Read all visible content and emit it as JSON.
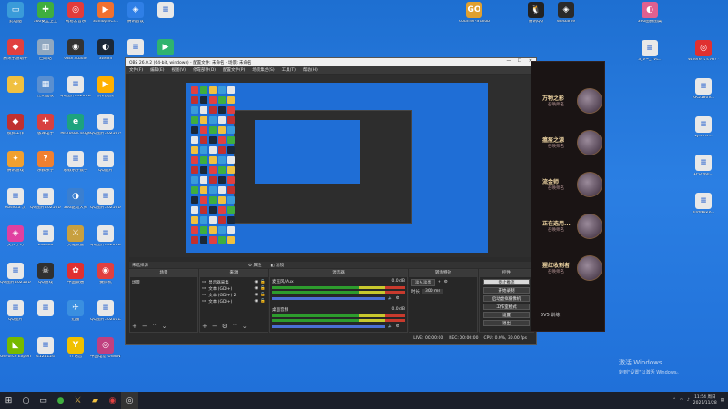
{
  "desktop_icons": [
    {
      "label": "此电脑",
      "color": "#3a9bd9",
      "glyph": "▭"
    },
    {
      "label": "360安全卫士",
      "color": "#3fae3f",
      "glyph": "✚"
    },
    {
      "label": "网易云音乐",
      "color": "#e33b3b",
      "glyph": "◎"
    },
    {
      "label": "SunloginCl...",
      "color": "#f07030",
      "glyph": "▶"
    },
    {
      "label": "腾讯会议",
      "color": "#2f7fe6",
      "glyph": "◈"
    },
    {
      "label": "",
      "color": "#e8e8e8",
      "glyph": ""
    },
    {
      "label": "腾讯手游助手",
      "color": "#e04040",
      "glyph": "◆"
    },
    {
      "label": "回收站",
      "color": "#8fa7c0",
      "glyph": "▥"
    },
    {
      "label": "OBS Studio",
      "color": "#333333",
      "glyph": "◉"
    },
    {
      "label": "Steam",
      "color": "#1b2838",
      "glyph": "◐"
    },
    {
      "label": "模式",
      "color": "#e8e8e8",
      "glyph": ""
    },
    {
      "label": "",
      "color": "#2fb36f",
      "glyph": "▶"
    },
    {
      "label": "",
      "color": "#f0c040",
      "glyph": "✦"
    },
    {
      "label": "控制面板",
      "color": "#5a8fd0",
      "glyph": "▦"
    },
    {
      "label": "QQ图片20201121...",
      "color": "#e8e8e8",
      "glyph": ""
    },
    {
      "label": "腾讯视频",
      "color": "#ffb000",
      "glyph": "▶"
    },
    {
      "label": "模式工作",
      "color": "#c03030",
      "glyph": "◆"
    },
    {
      "label": "极域电子",
      "color": "#d84040",
      "glyph": "✚"
    },
    {
      "label": "Microsoft Edge",
      "color": "#1da37e",
      "glyph": "e"
    },
    {
      "label": "QQ图片20210705...",
      "color": "#e8e8e8",
      "glyph": ""
    },
    {
      "label": "腾讯游戏",
      "color": "#f0a030",
      "glyph": "✦"
    },
    {
      "label": "乐教乐学",
      "color": "#f08030",
      "glyph": "?"
    },
    {
      "label": "乐教乐学数字",
      "color": "#e8e8e8",
      "glyph": ""
    },
    {
      "label": "QQ图片",
      "color": "#e8e8e8",
      "glyph": ""
    },
    {
      "label": "Rosetta 汉",
      "color": "#e8e8e8",
      "glyph": ""
    },
    {
      "label": "QQ图片20210107...",
      "color": "#e8e8e8",
      "glyph": ""
    },
    {
      "label": "360驱动大师",
      "color": "#3a7fd0",
      "glyph": "◑"
    },
    {
      "label": "QQ图片20210108...",
      "color": "#e8e8e8",
      "glyph": ""
    },
    {
      "label": "交大学习",
      "color": "#e040a0",
      "glyph": "◈"
    },
    {
      "label": "132380",
      "color": "#e8e8e8",
      "glyph": ""
    },
    {
      "label": "英雄联盟",
      "color": "#c8a040",
      "glyph": "⚔"
    },
    {
      "label": "QQ图片20201127...",
      "color": "#e8e8e8",
      "glyph": ""
    },
    {
      "label": "QQ图片20210107...",
      "color": "#e8e8e8",
      "glyph": ""
    },
    {
      "label": "QQ游戏",
      "color": "#303030",
      "glyph": "☠"
    },
    {
      "label": "中国联通",
      "color": "#e03030",
      "glyph": "✿"
    },
    {
      "label": "摄像机",
      "color": "#e04040",
      "glyph": "◉"
    },
    {
      "label": "QQ图片",
      "color": "#e8e8e8",
      "glyph": ""
    },
    {
      "label": "",
      "color": "#e8e8e8",
      "glyph": ""
    },
    {
      "label": "迅雷",
      "color": "#3a8fe0",
      "glyph": "✈"
    },
    {
      "label": "QQ图片20201126...",
      "color": "#e8e8e8",
      "glyph": ""
    },
    {
      "label": "GeForce Experience",
      "color": "#76b900",
      "glyph": "◣"
    },
    {
      "label": "4124124",
      "color": "#e8e8e8",
      "glyph": ""
    },
    {
      "label": "YY语音",
      "color": "#f0c000",
      "glyph": "Y"
    },
    {
      "label": "中国电信 UWAN...",
      "color": "#c04080",
      "glyph": "◎"
    },
    {
      "label": "79137cd...",
      "color": "#e8e8e8",
      "glyph": ""
    },
    {
      "label": "360安全浏览器",
      "color": "#3fae3f",
      "glyph": "e"
    },
    {
      "label": "QQ图片20210706...",
      "color": "#e8e8e8",
      "glyph": ""
    },
    {
      "label": "英雄联盟 WeGame",
      "color": "#c8a040",
      "glyph": "⚔"
    }
  ],
  "right_icons": [
    {
      "label": "Counter-S Global Off...",
      "color": "#e0a030",
      "glyph": "GO"
    },
    {
      "label": "腾讯QQ",
      "color": "#222222",
      "glyph": "🐧"
    },
    {
      "label": "WeGame",
      "color": "#2a2a2a",
      "glyph": "◈"
    },
    {
      "label": "360画报图集",
      "color": "#e06090",
      "glyph": "◐"
    },
    {
      "label": "Where It's AT? - Wiki...",
      "color": "#e03030",
      "glyph": "◎"
    },
    {
      "label": "'3_V~_YVL...",
      "color": "#e8e8e8",
      "glyph": ""
    },
    {
      "label": "KR5180V...",
      "color": "#e8e8e8",
      "glyph": ""
    },
    {
      "label": "1JM6%...",
      "color": "#e8e8e8",
      "glyph": ""
    },
    {
      "label": "1FO%0J...",
      "color": "#e8e8e8",
      "glyph": ""
    },
    {
      "label": "8YAN02V...",
      "color": "#e8e8e8",
      "glyph": ""
    }
  ],
  "obs": {
    "title": "OBS 26.0.2 (64-bit, windows) - 配置文件: 未命名 - 场景: 未命名",
    "menu": [
      "文件(F)",
      "编辑(E)",
      "视图(V)",
      "停靠部件(D)",
      "配置文件(P)",
      "场景集合(S)",
      "工具(T)",
      "帮助(H)"
    ],
    "source_bar": {
      "name": "未选择源",
      "properties": "属性",
      "filters": "滤镜"
    },
    "docks": {
      "scenes": {
        "title": "场景",
        "items": [
          "场景"
        ]
      },
      "sources": {
        "title": "来源",
        "items": [
          "显示器采集",
          "文本 (GDI+)",
          "文本 (GDI+) 2",
          "文本 (GDI+)"
        ]
      },
      "mixer": {
        "title": "混音器",
        "channels": [
          {
            "name": "麦克风/Aux",
            "level": "0.0 dB"
          },
          {
            "name": "桌面音频",
            "level": "0.0 dB"
          }
        ]
      },
      "transitions": {
        "title": "转场特效",
        "value": "淡入淡出",
        "duration_label": "时长",
        "duration": "300 ms"
      },
      "controls": {
        "title": "控件",
        "buttons": [
          "停止推流",
          "开始录制",
          "启动虚拟摄像机",
          "工作室模式",
          "设置",
          "退出"
        ]
      }
    },
    "status": {
      "live": "LIVE: 00:00:00",
      "rec": "REC: 00:00:00",
      "cpu": "CPU: 0.0%, 30.00 fps"
    }
  },
  "game_panel": {
    "players": [
      {
        "name": "万物之影",
        "sub": "召唤师名"
      },
      {
        "name": "瘟疫之源",
        "sub": "召唤师名"
      },
      {
        "name": "流金师",
        "sub": "召唤师名"
      },
      {
        "name": "正在选用...",
        "sub": "召唤师名"
      },
      {
        "name": "猩红收割者",
        "sub": "召唤师名"
      }
    ],
    "footer": "5V5 训练"
  },
  "taskbar": {
    "time": "11:54 周日",
    "date": "2021/11/28"
  },
  "watermark": {
    "line1": "激活 Windows",
    "line2": "转到\"设置\"以激活 Windows。"
  }
}
